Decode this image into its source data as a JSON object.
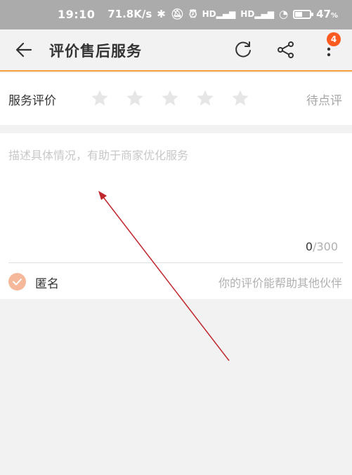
{
  "status_bar": {
    "time": "19:10",
    "network_speed": "71.8K/s",
    "battery_percent": "47",
    "battery_suffix": "%",
    "icons": [
      "bluetooth-icon",
      "mute-icon",
      "alarm-icon",
      "signal-hd-icon",
      "signal-hd-icon",
      "wifi-icon",
      "battery-icon"
    ]
  },
  "toolbar": {
    "title": "评价售后服务",
    "badge_count": "4",
    "accent_color": "#f6a13c"
  },
  "rating": {
    "label": "服务评价",
    "stars": [
      1,
      2,
      3,
      4,
      5
    ],
    "value": 0,
    "status": "待点评"
  },
  "review": {
    "placeholder": "描述具体情况，有助于商家优化服务",
    "value": "",
    "count_current": "0",
    "count_max": "/300"
  },
  "anonymous": {
    "label": "匿名",
    "hint": "你的评价能帮助其他伙伴",
    "checked": true
  },
  "colors": {
    "badge": "#ff5a1f",
    "check": "#f6b89a",
    "star_inactive": "#e6e6e6",
    "annotation_arrow": "#c0272d"
  }
}
